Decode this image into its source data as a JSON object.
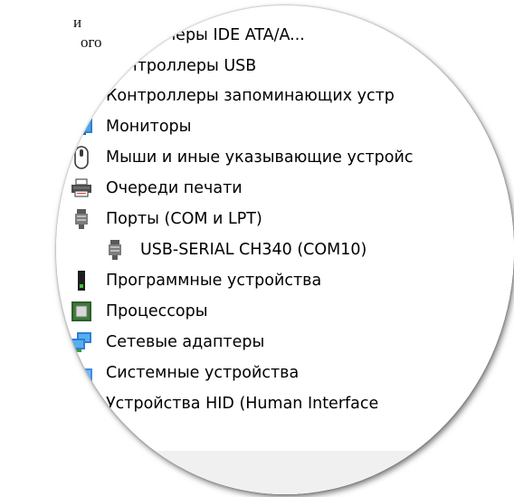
{
  "background_text": {
    "line1": "и",
    "line2": "ого"
  },
  "device_manager": {
    "items": [
      {
        "label": "роллеры IDE ATA/A...",
        "icon": "ide-controller-icon",
        "expanded": null
      },
      {
        "label": "контроллеры USB",
        "icon": "usb-controller-icon",
        "expanded": null
      },
      {
        "label": "Контроллеры запоминающих устр",
        "icon": "storage-controller-icon",
        "expanded": null
      },
      {
        "label": "Мониторы",
        "icon": "monitor-icon",
        "expanded": false
      },
      {
        "label": "Мыши и иные указывающие устройс",
        "icon": "mouse-icon",
        "expanded": false
      },
      {
        "label": "Очереди печати",
        "icon": "printer-icon",
        "expanded": false
      },
      {
        "label": "Порты (COM и LPT)",
        "icon": "port-icon",
        "expanded": true
      },
      {
        "label": "USB-SERIAL CH340 (COM10)",
        "icon": "port-icon",
        "expanded": null
      },
      {
        "label": "Программные устройства",
        "icon": "software-device-icon",
        "expanded": false
      },
      {
        "label": "Процессоры",
        "icon": "processor-icon",
        "expanded": false
      },
      {
        "label": "Сетевые адаптеры",
        "icon": "network-adapter-icon",
        "expanded": false
      },
      {
        "label": "Системные устройства",
        "icon": "system-devices-icon",
        "expanded": null
      },
      {
        "label": "Устройства HID (Human Interface",
        "icon": "hid-device-icon",
        "expanded": null
      }
    ]
  },
  "colors": {
    "text": "#000000",
    "chevron": "#606060",
    "panel_bottom": "#f0f0f0"
  }
}
